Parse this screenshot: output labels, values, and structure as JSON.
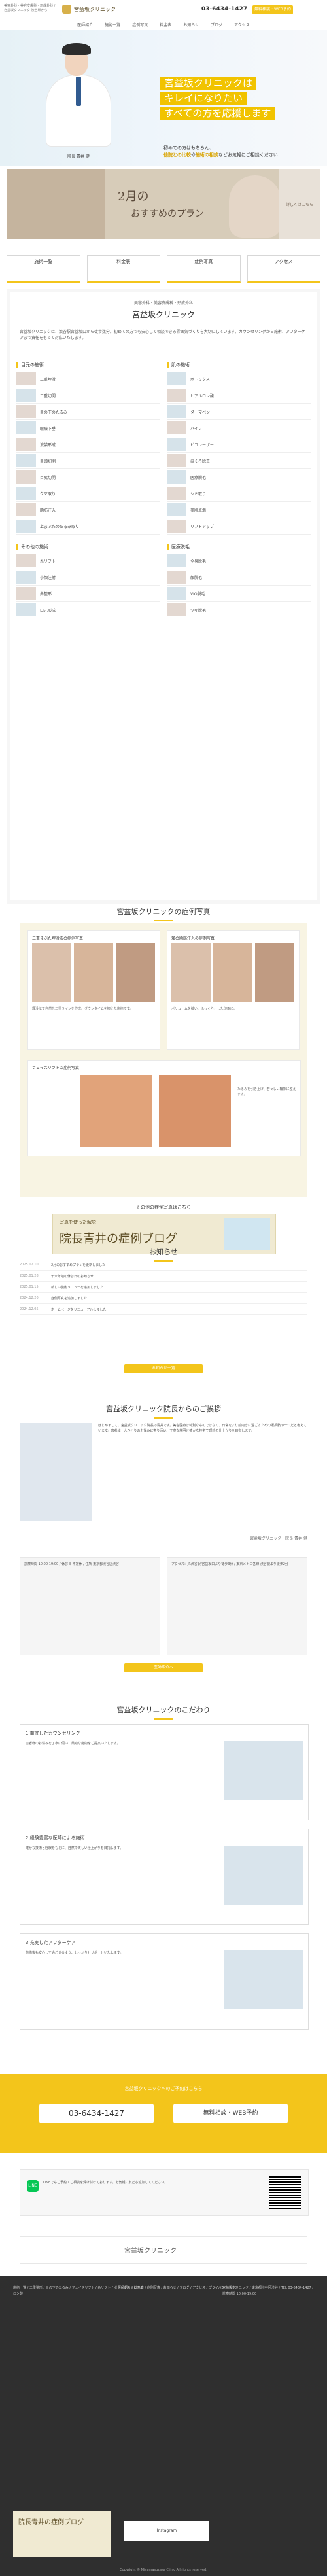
{
  "topbar": {
    "small_text": "美容外科・美容皮膚科・形成外科 / 宮益坂クリニック 渋谷駅から",
    "logo_text": "宮益坂クリニック",
    "phone": "03-6434-1427",
    "reserve_label": "無料相談・WEB予約"
  },
  "nav": {
    "items": [
      "医師紹介",
      "施術一覧",
      "症例写真",
      "料金表",
      "お知らせ",
      "ブログ",
      "アクセス"
    ]
  },
  "hero": {
    "caption": "院長 青井 健",
    "title_lines": [
      "宮益坂クリニックは",
      "キレイになりたい",
      "すべての方を応援します"
    ],
    "sub_lines": [
      "初めての方はもちろん、",
      "他院との比較",
      "や",
      "施術の相談",
      "など",
      "お気軽にご相談ください"
    ]
  },
  "banner": {
    "title": "2月の",
    "subtitle": "おすすめのプラン",
    "side": "詳しくはこちら"
  },
  "quick_links": [
    "施術一覧",
    "料金表",
    "症例写真",
    "アクセス"
  ],
  "intro": {
    "top": "美容外科・美容皮膚科・形成外科",
    "title": "宮益坂クリニック",
    "body": "宮益坂クリニックは、渋谷駅宮益坂口から徒歩数分。初めての方でも安心して相談できる雰囲気づくりを大切にしています。カウンセリングから施術、アフターケアまで責任をもって対応いたします。"
  },
  "columns": {
    "left_title": "目元の施術",
    "right_title": "肌の施術",
    "left_items": [
      "二重埋没",
      "二重切開",
      "目の下のたるみ",
      "眼瞼下垂",
      "涙袋形成",
      "目頭切開",
      "目尻切開",
      "クマ取り",
      "脂肪注入",
      "上まぶたのたるみ取り"
    ],
    "right_items": [
      "ボトックス",
      "ヒアルロン酸",
      "ダーマペン",
      "ハイフ",
      "ピコレーザー",
      "ほくろ除去",
      "医療脱毛",
      "シミ取り",
      "美肌点滴",
      "リフトアップ"
    ],
    "left_extra_title": "その他の施術",
    "left_extra_items": [
      "糸リフト",
      "小顔注射",
      "鼻整形",
      "口元形成"
    ],
    "right_extra_title": "医療脱毛",
    "right_extra_items": [
      "全身脱毛",
      "顔脱毛",
      "VIO脱毛",
      "ワキ脱毛"
    ]
  },
  "cases": {
    "heading": "宮益坂クリニックの症例写真",
    "cards": [
      {
        "label": "二重まぶた埋没法の症例写真",
        "desc": "埋没法で自然な二重ラインを作成。ダウンタイムを抑えた施術です。"
      },
      {
        "label": "頬の脂肪注入の症例写真",
        "desc": "ボリュームを補い、ふっくらとした印象に。"
      }
    ],
    "big": {
      "label": "フェイスリフトの症例写真",
      "desc": "たるみを引き上げ、若々しい輪郭に整えます。"
    },
    "link": "その他の症例写真はこちら"
  },
  "blog_banner": {
    "line1": "写真を使った解説",
    "line2": "院長青井の",
    "line3": "症例ブログ"
  },
  "news": {
    "heading": "お知らせ",
    "items": [
      {
        "date": "2025.02.10",
        "text": "2月のおすすめプランを更新しました"
      },
      {
        "date": "2025.01.28",
        "text": "年末年始の休診日のお知らせ"
      },
      {
        "date": "2025.01.15",
        "text": "新しい施術メニューを追加しました"
      },
      {
        "date": "2024.12.20",
        "text": "症例写真を追加しました"
      },
      {
        "date": "2024.12.05",
        "text": "ホームページをリニューアルしました"
      }
    ],
    "more": "お知らせ一覧"
  },
  "director": {
    "heading": "宮益坂クリニック院長からのご挨拶",
    "text": "はじめまして。宮益坂クリニック院長の青井です。美容医療は特別なものではなく、日常をより前向きに過ごすための選択肢の一つだと考えています。患者様一人ひとりのお悩みに寄り添い、丁寧な説明と確かな技術で理想の仕上がりを目指します。",
    "signature": "宮益坂クリニック　院長 青井 健"
  },
  "info": {
    "left": "診療時間 10:00-19:00 / 休診日 不定休 / 住所 東京都渋谷区渋谷",
    "right": "アクセス：JR渋谷駅 宮益坂口より徒歩3分 / 東京メトロ各線 渋谷駅より徒歩2分"
  },
  "director_more": "医師紹介へ",
  "features": {
    "heading": "宮益坂クリニックのこだわり",
    "items": [
      {
        "title": "1 徹底したカウンセリング",
        "text": "患者様のお悩みを丁寧に伺い、最適な施術をご提案いたします。"
      },
      {
        "title": "2 経験豊富な医師による施術",
        "text": "確かな技術と経験をもとに、自然で美しい仕上がりを目指します。"
      },
      {
        "title": "3 充実したアフターケア",
        "text": "施術後も安心して過ごせるよう、しっかりとサポートいたします。"
      }
    ]
  },
  "cta": {
    "title": "宮益坂クリニックへのご予約はこちら",
    "phone": "03-6434-1427",
    "button": "無料相談・WEB予約"
  },
  "line": {
    "label": "LINE",
    "text": "LINEでもご予約・ご相談を受け付けております。お気軽に友だち追加してください。"
  },
  "footer": {
    "logo": "宮益坂クリニック",
    "col1": "施術一覧 / 二重整形 / 目の下のたるみ / フェイスリフト / 糸リフト / ボトックス / ヒアルロン酸",
    "col2": "医師紹介 / 料金表 / 症例写真 / お知らせ / ブログ / アクセス / プライバシーポリシー",
    "col3": "宮益坂クリニック / 東京都渋谷区渋谷 / TEL 03-6434-1427 / 診療時間 10:00-19:00",
    "blog": "院長青井の症例ブログ",
    "insta": "Instagram",
    "copyright": "Copyright © Miyamasuzaka Clinic All rights reserved."
  },
  "colors": {
    "accent": "#f3c51b",
    "bg": "#ffffff"
  }
}
